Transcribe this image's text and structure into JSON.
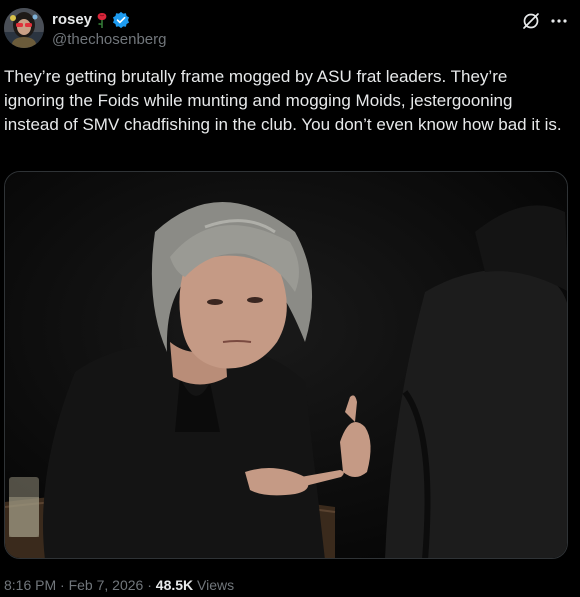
{
  "author": {
    "display_name": "rosey",
    "handle": "@thechosenberg",
    "verified": true,
    "name_emoji": "rose-icon",
    "avatar": "profile-avatar"
  },
  "post": {
    "text": "They’re getting brutally frame mogged by ASU frat leaders. They’re ignoring the Foids while munting and mogging Moids, jestergooning instead of SMV chadfishing in the club. You don’t even know how bad it is.",
    "media": "video-still"
  },
  "header_actions": {
    "grok_icon": "grok-icon",
    "more_icon": "more-icon"
  },
  "meta": {
    "time": "8:16 PM",
    "separator_1": " · ",
    "date": "Feb 7, 2026",
    "separator_2": " · ",
    "views_count": "48.5K",
    "views_label": " Views"
  },
  "colors": {
    "background": "#000000",
    "text_primary": "#e7e9ea",
    "text_secondary": "#71767b",
    "verified_blue": "#1d9bf0",
    "border": "#2f3336"
  }
}
